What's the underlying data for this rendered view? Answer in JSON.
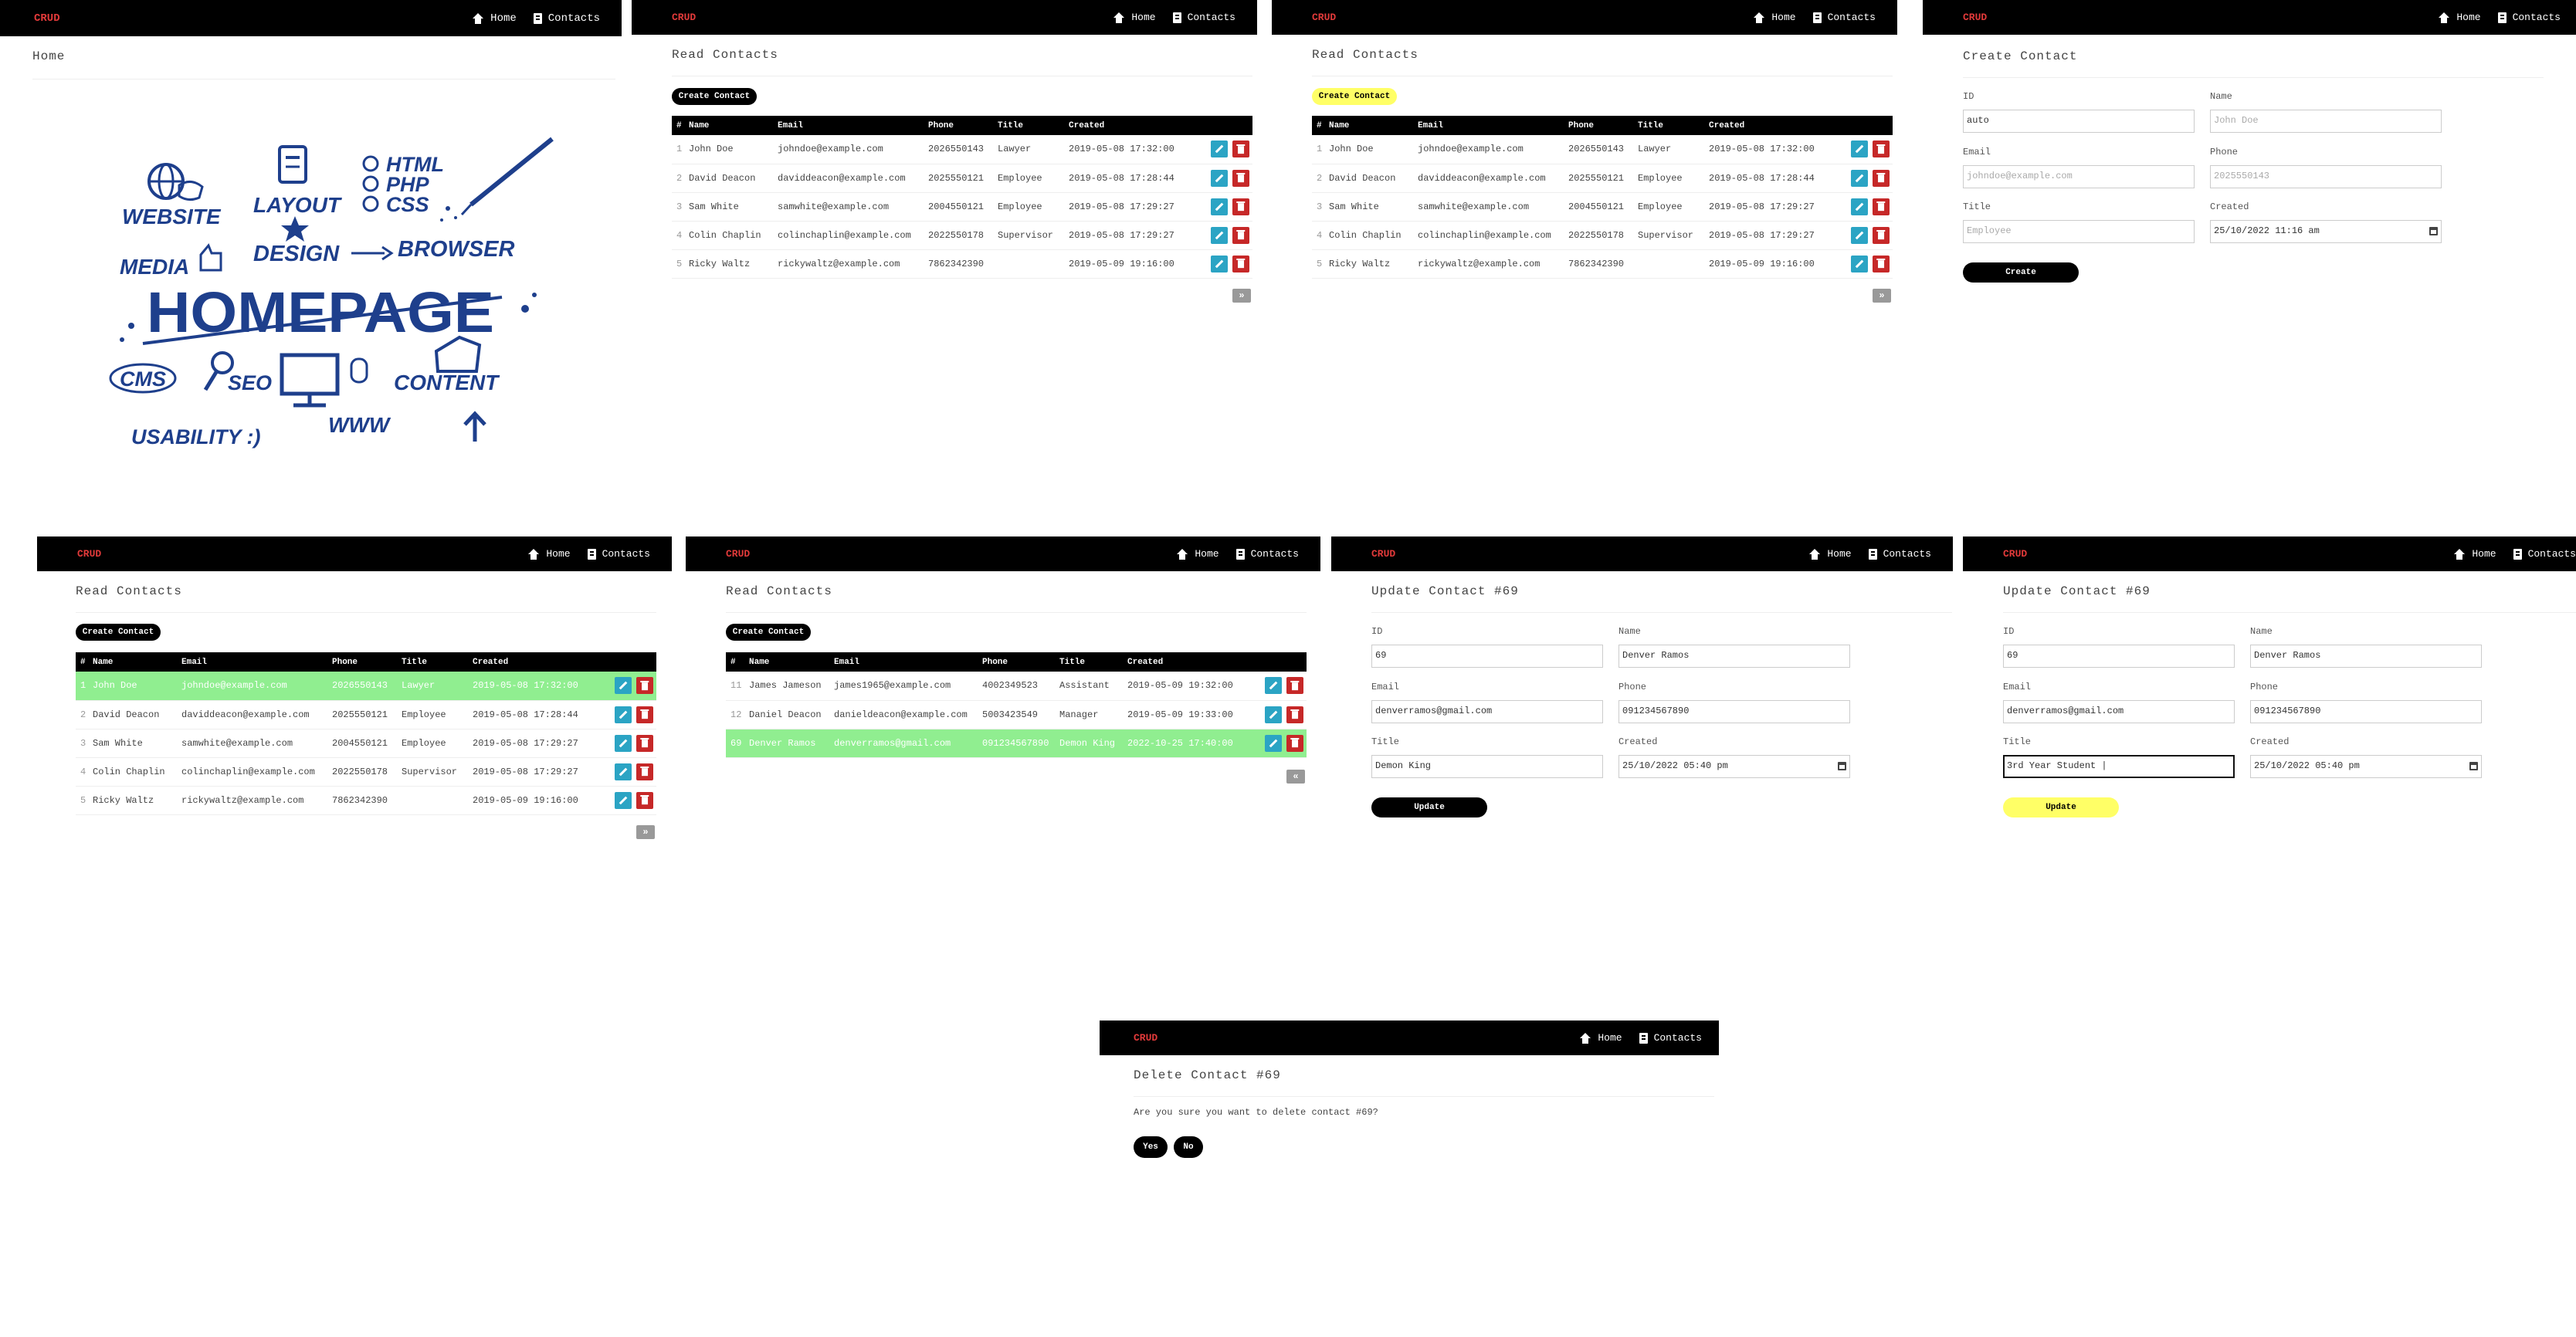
{
  "nav": {
    "brand": "CRUD",
    "home": "Home",
    "contacts": "Contacts"
  },
  "panel_home": {
    "title": "Home"
  },
  "homepage_art": {
    "headline": "HOMEPAGE",
    "words": [
      "WEBSITE",
      "LAYOUT",
      "HTML",
      "PHP",
      "CSS",
      "MEDIA",
      "DESIGN",
      "BROWSER",
      "CMS",
      "SEO",
      "CONTENT",
      "USABILITY :)",
      "WWW"
    ]
  },
  "panel_read1": {
    "title": "Read Contacts",
    "create_label": "Create Contact"
  },
  "panel_read2": {
    "title": "Read Contacts",
    "create_label": "Create Contact"
  },
  "panel_read3": {
    "title": "Read Contacts",
    "create_label": "Create Contact"
  },
  "panel_read4": {
    "title": "Read Contacts",
    "create_label": "Create Contact"
  },
  "table_headers": {
    "id": "#",
    "name": "Name",
    "email": "Email",
    "phone": "Phone",
    "title": "Title",
    "created": "Created"
  },
  "pager_next": "»",
  "pager_prev": "«",
  "contacts_page1": [
    {
      "id": "1",
      "name": "John Doe",
      "email": "johndoe@example.com",
      "phone": "2026550143",
      "title": "Lawyer",
      "created": "2019-05-08 17:32:00"
    },
    {
      "id": "2",
      "name": "David Deacon",
      "email": "daviddeacon@example.com",
      "phone": "2025550121",
      "title": "Employee",
      "created": "2019-05-08 17:28:44"
    },
    {
      "id": "3",
      "name": "Sam White",
      "email": "samwhite@example.com",
      "phone": "2004550121",
      "title": "Employee",
      "created": "2019-05-08 17:29:27"
    },
    {
      "id": "4",
      "name": "Colin Chaplin",
      "email": "colinchaplin@example.com",
      "phone": "2022550178",
      "title": "Supervisor",
      "created": "2019-05-08 17:29:27"
    },
    {
      "id": "5",
      "name": "Ricky Waltz",
      "email": "rickywaltz@example.com",
      "phone": "7862342390",
      "title": "",
      "created": "2019-05-09 19:16:00"
    }
  ],
  "contacts_page3": [
    {
      "id": "11",
      "name": "James Jameson",
      "email": "james1965@example.com",
      "phone": "4002349523",
      "title": "Assistant",
      "created": "2019-05-09 19:32:00"
    },
    {
      "id": "12",
      "name": "Daniel Deacon",
      "email": "danieldeacon@example.com",
      "phone": "5003423549",
      "title": "Manager",
      "created": "2019-05-09 19:33:00"
    },
    {
      "id": "69",
      "name": "Denver Ramos",
      "email": "denverramos@gmail.com",
      "phone": "091234567890",
      "title": "Demon King",
      "created": "2022-10-25 17:40:00"
    }
  ],
  "panel_create": {
    "title": "Create Contact",
    "labels": {
      "id": "ID",
      "name": "Name",
      "email": "Email",
      "phone": "Phone",
      "title": "Title",
      "created": "Created"
    },
    "values": {
      "id": "auto",
      "name": "John Doe",
      "email": "johndoe@example.com",
      "phone": "2025550143",
      "title": "Employee",
      "created": "25/10/2022 11:16 am"
    },
    "submit": "Create"
  },
  "panel_update1": {
    "title": "Update Contact #69",
    "labels": {
      "id": "ID",
      "name": "Name",
      "email": "Email",
      "phone": "Phone",
      "title": "Title",
      "created": "Created"
    },
    "values": {
      "id": "69",
      "name": "Denver Ramos",
      "email": "denverramos@gmail.com",
      "phone": "091234567890",
      "title": "Demon King",
      "created": "25/10/2022 05:40 pm"
    },
    "submit": "Update"
  },
  "panel_update2": {
    "title": "Update Contact #69",
    "labels": {
      "id": "ID",
      "name": "Name",
      "email": "Email",
      "phone": "Phone",
      "title": "Title",
      "created": "Created"
    },
    "values": {
      "id": "69",
      "name": "Denver Ramos",
      "email": "denverramos@gmail.com",
      "phone": "091234567890",
      "title": "3rd Year Student |",
      "created": "25/10/2022 05:40 pm"
    },
    "submit": "Update"
  },
  "panel_delete": {
    "title": "Delete Contact #69",
    "question": "Are you sure you want to delete contact #69?",
    "yes": "Yes",
    "no": "No"
  },
  "colors": {
    "brand": "#e23a3a",
    "navbar": "#000000",
    "highlight": "#ffff66",
    "selected_row": "#90ee90",
    "edit": "#2ba4c4",
    "delete": "#c62828"
  }
}
